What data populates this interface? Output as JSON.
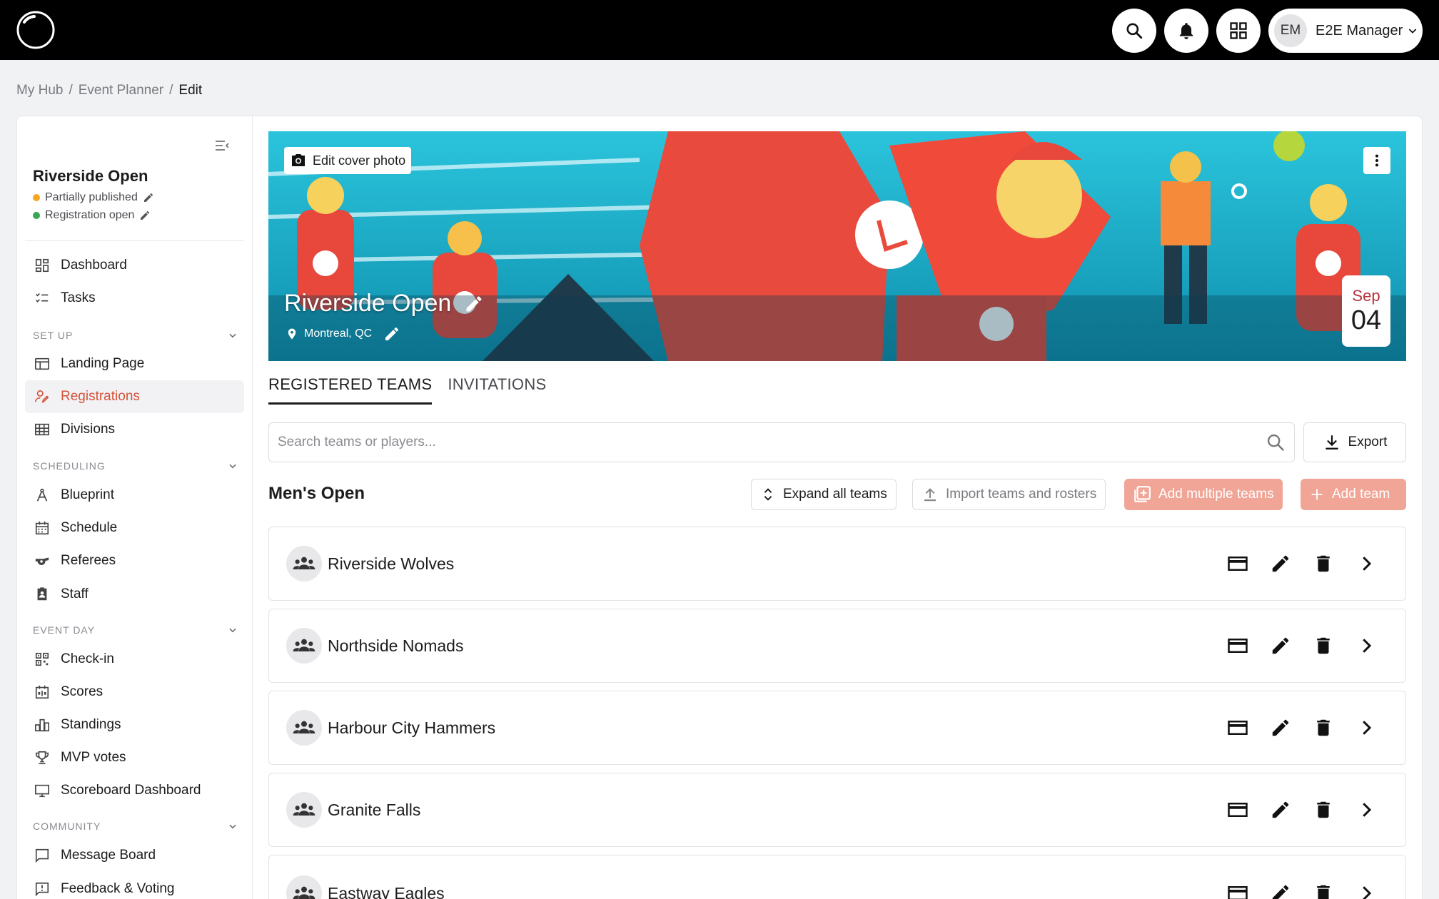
{
  "header": {
    "user_initials": "EM",
    "user_name": "E2E Manager"
  },
  "breadcrumb": {
    "items": [
      "My Hub",
      "Event Planner",
      "Edit"
    ]
  },
  "sidebar": {
    "event_name": "Riverside Open",
    "statuses": [
      {
        "label": "Partially published",
        "color": "#f5a623"
      },
      {
        "label": "Registration open",
        "color": "#34a853"
      }
    ],
    "top_items": [
      {
        "label": "Dashboard",
        "icon": "dashboard-icon"
      },
      {
        "label": "Tasks",
        "icon": "tasks-icon"
      }
    ],
    "sections": [
      {
        "label": "SET UP",
        "items": [
          {
            "label": "Landing Page",
            "icon": "landing-page-icon"
          },
          {
            "label": "Registrations",
            "icon": "registrations-icon"
          },
          {
            "label": "Divisions",
            "icon": "divisions-icon"
          }
        ]
      },
      {
        "label": "SCHEDULING",
        "items": [
          {
            "label": "Blueprint",
            "icon": "blueprint-icon"
          },
          {
            "label": "Schedule",
            "icon": "schedule-icon"
          },
          {
            "label": "Referees",
            "icon": "whistle-icon"
          },
          {
            "label": "Staff",
            "icon": "staff-icon"
          }
        ]
      },
      {
        "label": "EVENT DAY",
        "items": [
          {
            "label": "Check-in",
            "icon": "qr-icon"
          },
          {
            "label": "Scores",
            "icon": "scores-icon"
          },
          {
            "label": "Standings",
            "icon": "standings-icon"
          },
          {
            "label": "MVP votes",
            "icon": "trophy-icon"
          },
          {
            "label": "Scoreboard Dashboard",
            "icon": "monitor-icon"
          }
        ]
      },
      {
        "label": "COMMUNITY",
        "items": [
          {
            "label": "Message Board",
            "icon": "message-icon"
          },
          {
            "label": "Feedback & Voting",
            "icon": "feedback-icon"
          }
        ]
      }
    ]
  },
  "cover": {
    "edit_label": "Edit cover photo",
    "title": "Riverside Open",
    "location": "Montreal, QC",
    "date_month": "Sep",
    "date_day": "04"
  },
  "tabs": [
    {
      "label": "REGISTERED TEAMS",
      "active": true
    },
    {
      "label": "INVITATIONS",
      "active": false
    }
  ],
  "search": {
    "placeholder": "Search teams or players...",
    "value": ""
  },
  "toolbar": {
    "export_label": "Export",
    "division_title": "Men's Open",
    "expand_label": "Expand all teams",
    "import_label": "Import teams and rosters",
    "add_multiple_label": "Add multiple teams",
    "add_team_label": "Add team"
  },
  "teams": [
    {
      "name": "Riverside Wolves"
    },
    {
      "name": "Northside Nomads"
    },
    {
      "name": "Harbour City Hammers"
    },
    {
      "name": "Granite Falls"
    },
    {
      "name": "Eastway Eagles"
    }
  ],
  "colors": {
    "accent": "#d4533a",
    "salmon_button": "#f0a597",
    "cover_bg": "#19b2cf"
  }
}
